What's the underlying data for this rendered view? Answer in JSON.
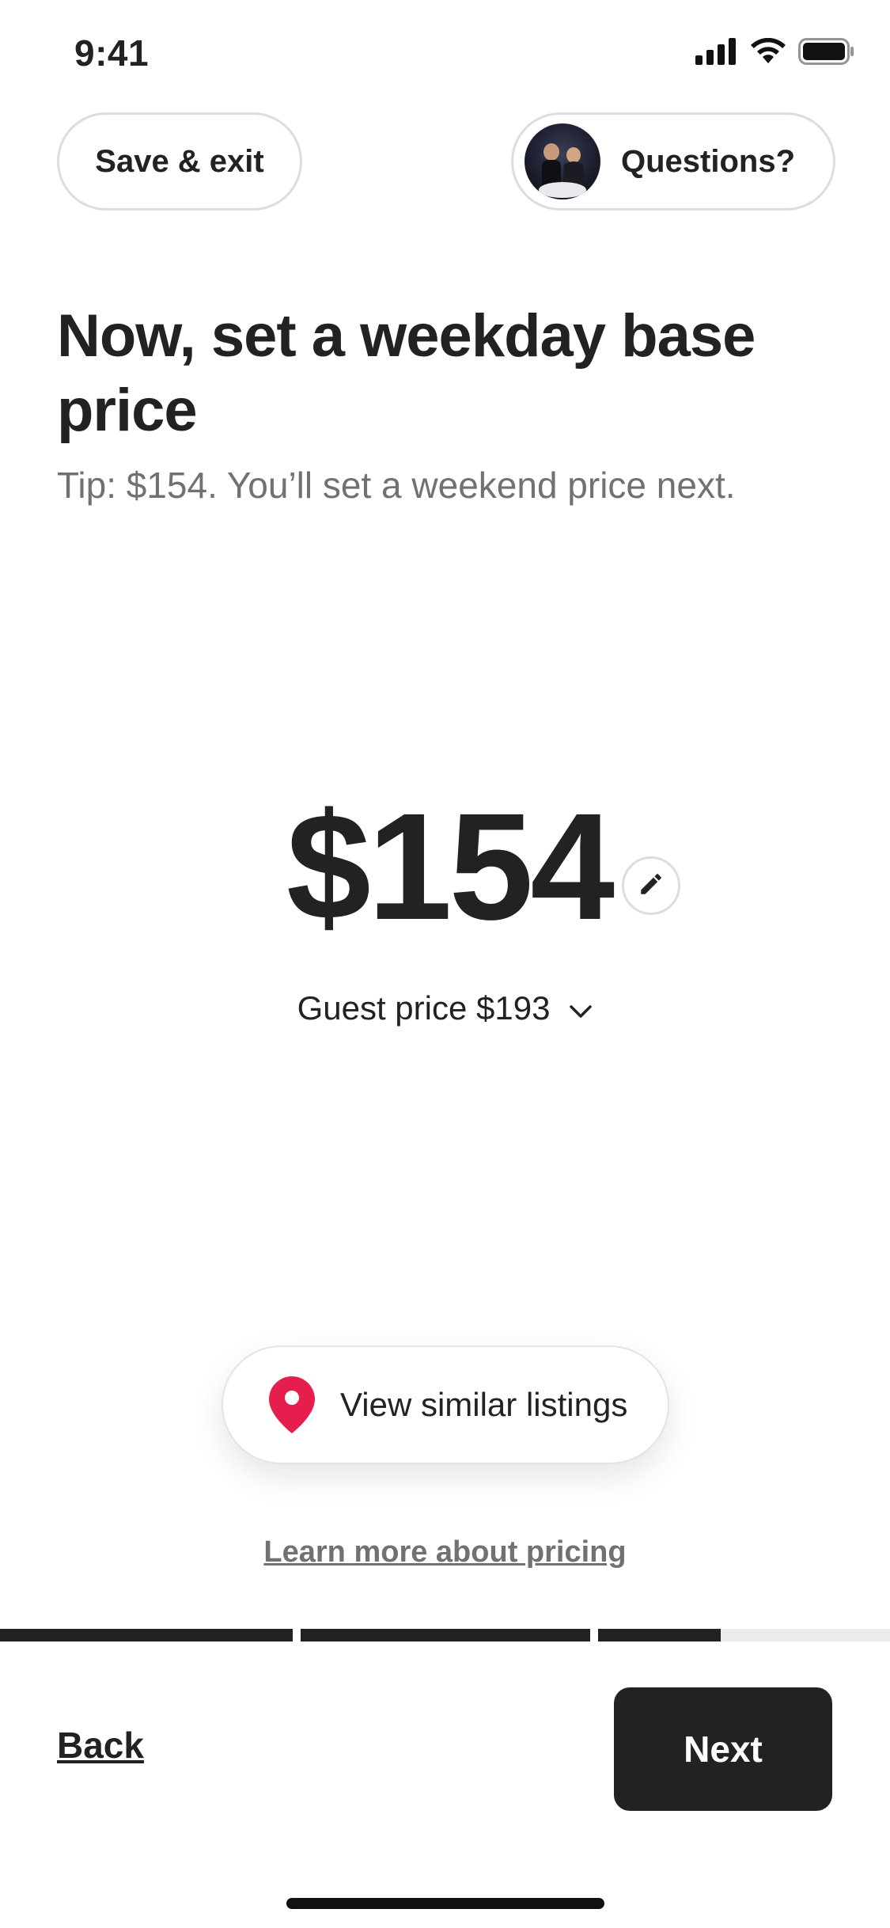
{
  "status_bar": {
    "time": "9:41",
    "icons": [
      "signal-icon",
      "wifi-icon",
      "battery-icon"
    ]
  },
  "header": {
    "save_exit_label": "Save & exit",
    "questions_label": "Questions?",
    "avatar_icon": "host-avatar"
  },
  "main": {
    "title": "Now, set a weekday base price",
    "tip": "Tip: $154. You’ll set a weekend price next.",
    "price": "$154",
    "edit_icon": "pencil-icon",
    "guest_price": "Guest price $193",
    "guest_price_toggle_icon": "chevron-down-icon",
    "similar_listings_label": "View similar listings",
    "similar_listings_icon": "map-pin-icon",
    "learn_more_label": "Learn more about pricing"
  },
  "progress": {
    "segments": [
      1.0,
      1.0,
      0.42
    ],
    "colors": {
      "filled": "#222222",
      "empty": "#ebebeb"
    }
  },
  "footer": {
    "back_label": "Back",
    "next_label": "Next"
  },
  "colors": {
    "accent": "#e61e4d",
    "text_primary": "#222222",
    "text_secondary": "#717171"
  }
}
